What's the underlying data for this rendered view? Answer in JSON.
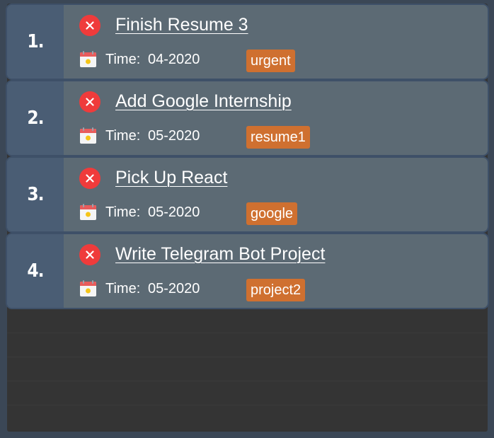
{
  "tasks": [
    {
      "index": "1.",
      "title": "Finish Resume 3",
      "time_label": "Time:",
      "time": "04-2020",
      "tag": "urgent"
    },
    {
      "index": "2.",
      "title": "Add Google Internship",
      "time_label": "Time:",
      "time": "05-2020",
      "tag": "resume1"
    },
    {
      "index": "3.",
      "title": "Pick Up React",
      "time_label": "Time:",
      "time": "05-2020",
      "tag": "google"
    },
    {
      "index": "4.",
      "title": "Write Telegram Bot Project",
      "time_label": "Time:",
      "time": "05-2020",
      "tag": "project2"
    }
  ],
  "icons": {
    "delete": "close-circle-icon",
    "date": "calendar-icon"
  },
  "colors": {
    "card_bg": "#5c6a74",
    "index_bg": "#4a5d74",
    "delete_red": "#ef3b3b",
    "tag_orange": "#cf7030",
    "list_bg": "#343434",
    "window_bg": "#3b4756"
  }
}
